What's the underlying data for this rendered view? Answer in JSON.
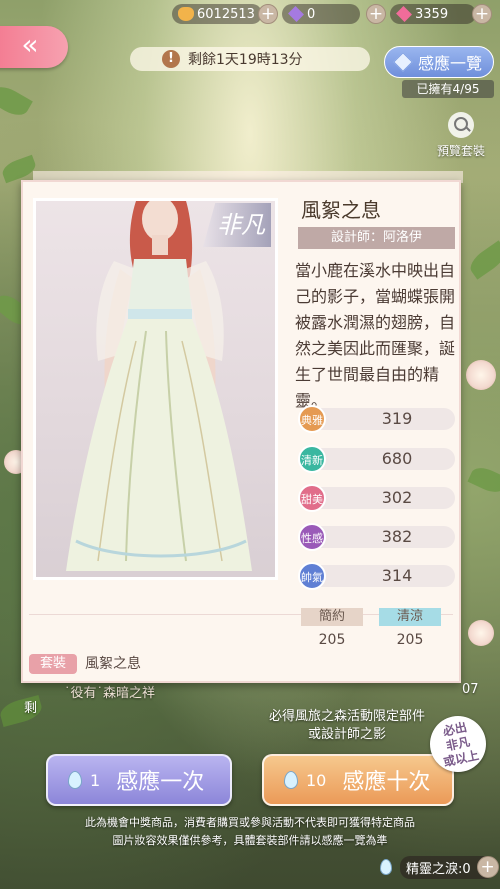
{
  "currency": {
    "gold": "6012513",
    "purple_gems": "0",
    "pink_diamonds": "3359"
  },
  "event": {
    "timer_text": "剩餘1天19時13分"
  },
  "collection": {
    "button_label": "感應一覽",
    "owned_text": "已擁有4/95"
  },
  "preview": {
    "label": "預覽套裝"
  },
  "item": {
    "rarity": "非凡",
    "name": "風絮之息",
    "designer": "設計師：阿洛伊",
    "description": "當小鹿在溪水中映出自己的影子，當蝴蝶張開被露水潤濕的翅膀，自然之美因此而匯聚，誕生了世間最自由的精靈。",
    "stats": [
      {
        "label": "典雅",
        "value": "319",
        "color": "#e59a52"
      },
      {
        "label": "清新",
        "value": "680",
        "color": "#3ab7a0"
      },
      {
        "label": "甜美",
        "value": "302",
        "color": "#e16d8a"
      },
      {
        "label": "性感",
        "value": "382",
        "color": "#9a5ab8"
      },
      {
        "label": "帥氣",
        "value": "314",
        "color": "#5f7fd4"
      }
    ],
    "tags": [
      {
        "label": "簡約",
        "value": "205",
        "color": "#e6d4c8"
      },
      {
        "label": "清涼",
        "value": "205",
        "color": "#a6dce6"
      }
    ],
    "set_badge": "套裝",
    "set_name": "風絮之息"
  },
  "background_text": {
    "left_frag": "剩",
    "item_frag": "˙役有˙森暗之祥",
    "hint": "必得風旅之森活動限定部件\n或設計師之影",
    "count_frag": "07"
  },
  "summon": {
    "one_count": "1",
    "one_label": "感應一次",
    "ten_count": "10",
    "ten_label": "感應十次",
    "special_badge": "必出\n非凡\n或以上"
  },
  "disclaimer": {
    "line1": "此為機會中獎商品，消費者購買或參與活動不代表即可獲得特定商品",
    "line2": "圖片妝容效果僅供參考，具體套裝部件請以感應一覽為準"
  },
  "spirit_tears": {
    "label": "精靈之淚:0"
  }
}
